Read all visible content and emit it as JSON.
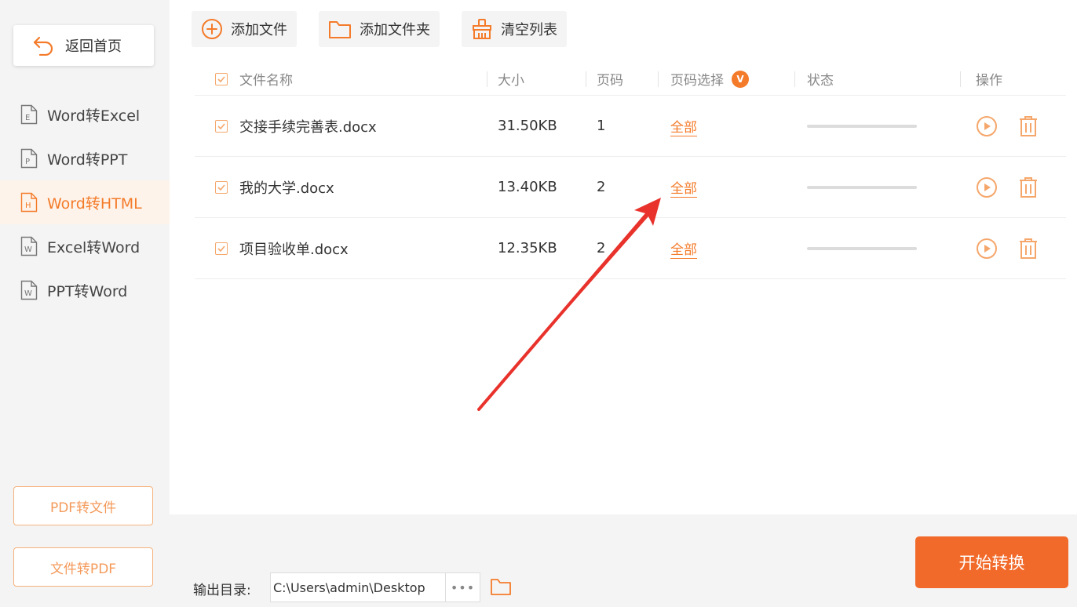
{
  "sidebar": {
    "back_label": "返回首页",
    "items": [
      {
        "label": "Word转Excel",
        "icon": "E",
        "active": false
      },
      {
        "label": "Word转PPT",
        "icon": "P",
        "active": false
      },
      {
        "label": "Word转HTML",
        "icon": "H",
        "active": true
      },
      {
        "label": "Excel转Word",
        "icon": "W",
        "active": false
      },
      {
        "label": "PPT转Word",
        "icon": "W",
        "active": false
      }
    ],
    "pdf_to_file": "PDF转文件",
    "file_to_pdf": "文件转PDF"
  },
  "toolbar": {
    "add_file": "添加文件",
    "add_folder": "添加文件夹",
    "clear_list": "清空列表"
  },
  "table": {
    "headers": {
      "name": "文件名称",
      "size": "大小",
      "pages": "页码",
      "page_select": "页码选择",
      "page_select_badge": "V",
      "status": "状态",
      "ops": "操作"
    },
    "rows": [
      {
        "name": "交接手续完善表.docx",
        "size": "31.50KB",
        "pages": "1",
        "selection": "全部",
        "progress": 0
      },
      {
        "name": "我的大学.docx",
        "size": "13.40KB",
        "pages": "2",
        "selection": "全部",
        "progress": 0
      },
      {
        "name": "项目验收单.docx",
        "size": "12.35KB",
        "pages": "2",
        "selection": "全部",
        "progress": 0
      }
    ]
  },
  "footer": {
    "output_label": "输出目录:",
    "output_path": "C:\\Users\\admin\\Desktop",
    "more": "•••",
    "start_label": "开始转换"
  },
  "colors": {
    "accent": "#f47b2a",
    "start_button": "#f26a2a",
    "active_bg": "#fdf3ea",
    "annotation_arrow": "#e8322b"
  }
}
